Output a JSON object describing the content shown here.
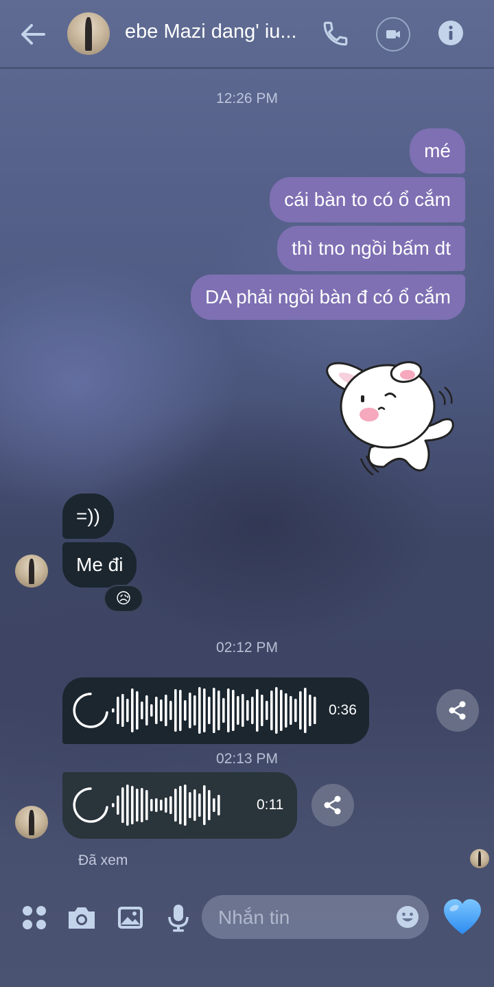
{
  "header": {
    "contact_name": "ebe Mazi dang' iu..."
  },
  "timestamps": {
    "t1": "12:26 PM",
    "t2": "02:12 PM",
    "t3": "02:13 PM"
  },
  "outgoing": [
    "mé",
    "cái bàn to có ổ cắm",
    "thì tno ngồi bấm dt",
    "DA phải ngồi bàn đ có ổ cắm"
  ],
  "incoming": [
    "=))",
    "Me đi"
  ],
  "reaction": "😥",
  "voice_messages": [
    {
      "duration": "0:36"
    },
    {
      "duration": "0:11"
    }
  ],
  "status": {
    "seen": "Đã xem"
  },
  "composer": {
    "placeholder": "Nhắn tin"
  },
  "colors": {
    "outgoing_bubble": "#7e70b3",
    "incoming_bubble": "#1b262f",
    "icon_accent": "#c3d4ea",
    "like_heart": "#4ca8ff"
  }
}
